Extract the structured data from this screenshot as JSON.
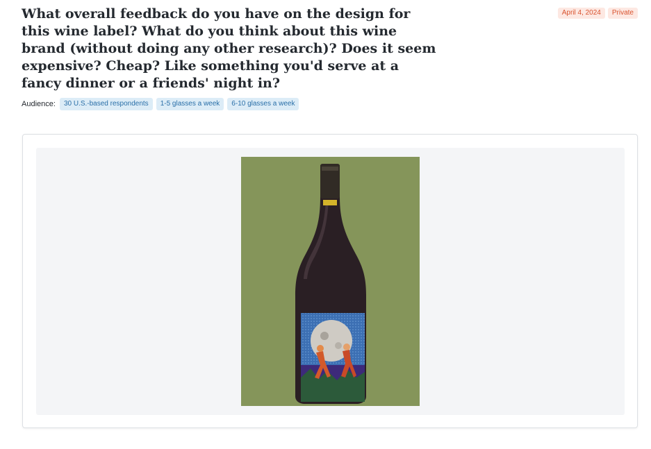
{
  "question": {
    "text": "What overall feedback do you have on the design for this wine label? What do you think about this wine brand (without doing any other research)? Does it seem expensive? Cheap? Like something you'd serve at a fancy dinner or a friends' night in?"
  },
  "meta": {
    "date": "April 4, 2024",
    "visibility": "Private"
  },
  "audience": {
    "label": "Audience:",
    "chips": [
      "30 U.S.-based respondents",
      "1-5 glasses a week",
      "6-10 glasses a week"
    ]
  },
  "colors": {
    "photo_background": "#85955a",
    "badge_text": "#d9532f",
    "chip_text": "#2a6fa8"
  }
}
